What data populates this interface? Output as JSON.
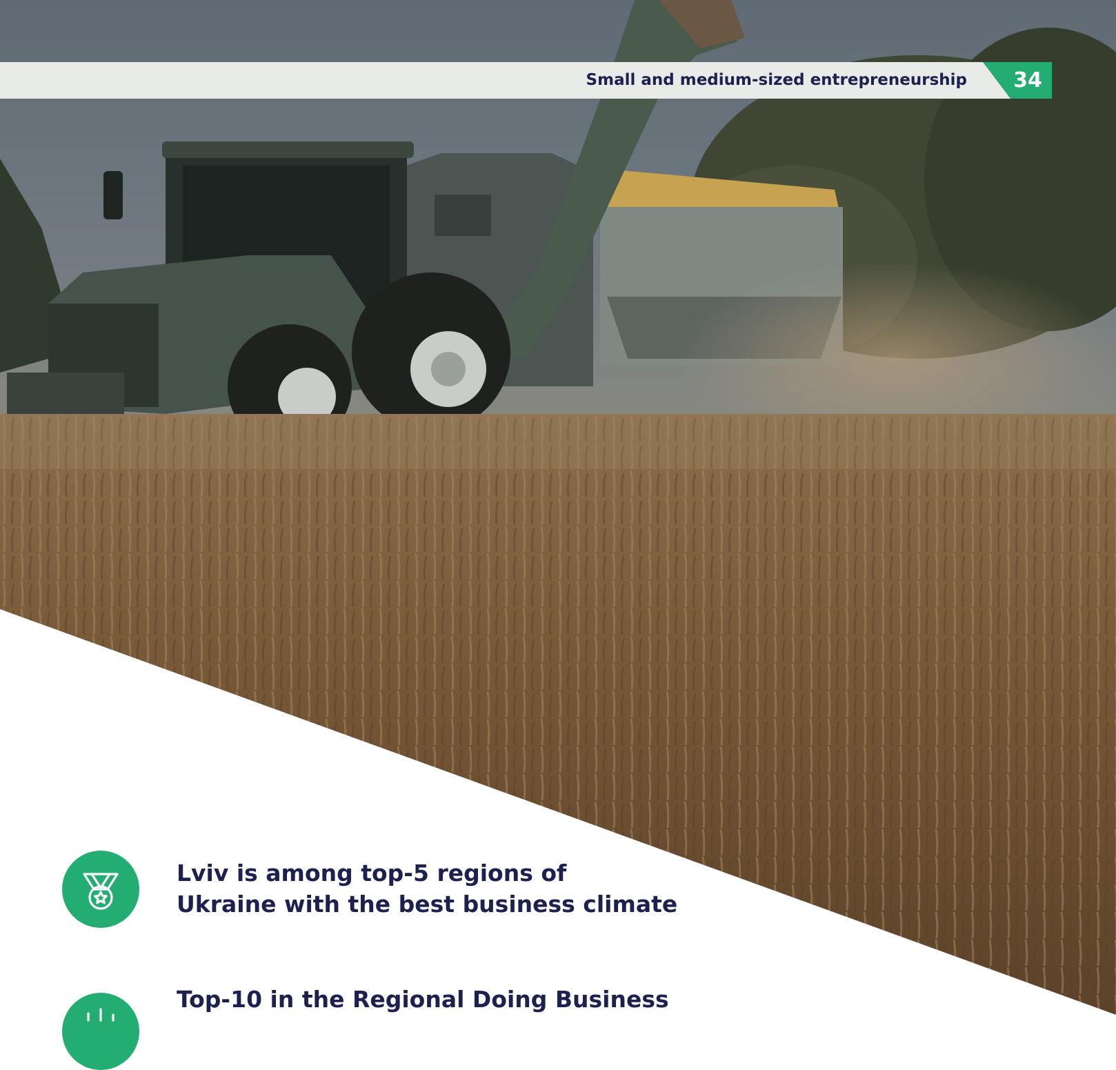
{
  "header": {
    "section_title": "Small and medium-sized entrepreneurship",
    "page_number": "34"
  },
  "photo": {
    "subject": "tractor-harvest-field-photo"
  },
  "facts": [
    {
      "icon": "medal-icon",
      "line1": "Lviv is among top-5 regions of",
      "line2": "Ukraine with the best business climate"
    },
    {
      "icon": "rank-icon",
      "line1": "Top-10 in the Regional Doing Business"
    }
  ],
  "colors": {
    "accent_green": "#24ad73",
    "heading_navy": "#1d2150",
    "header_band": "#e8ebe8"
  }
}
